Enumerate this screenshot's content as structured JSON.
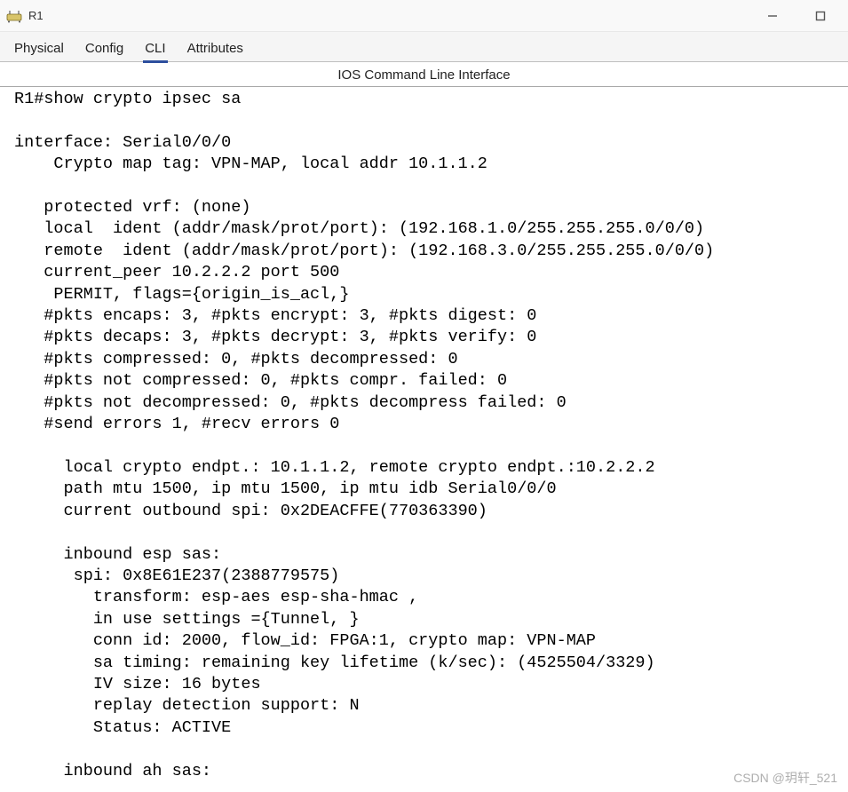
{
  "window": {
    "title": "R1",
    "icon_name": "router-icon"
  },
  "tabs": [
    {
      "label": "Physical",
      "active": false
    },
    {
      "label": "Config",
      "active": false
    },
    {
      "label": "CLI",
      "active": true
    },
    {
      "label": "Attributes",
      "active": false
    }
  ],
  "cli": {
    "subtitle": "IOS Command Line Interface",
    "prompt_line": "R1#show crypto ipsec sa",
    "interface_line": "interface: Serial0/0/0",
    "crypto_map_line": "    Crypto map tag: VPN-MAP, local addr 10.1.1.2",
    "protected_vrf": "   protected vrf: (none)",
    "local_ident": "   local  ident (addr/mask/prot/port): (192.168.1.0/255.255.255.0/0/0)",
    "remote_ident": "   remote  ident (addr/mask/prot/port): (192.168.3.0/255.255.255.0/0/0)",
    "current_peer": "   current_peer 10.2.2.2 port 500",
    "permit_line": "    PERMIT, flags={origin_is_acl,}",
    "pkts_encaps": "   #pkts encaps: 3, #pkts encrypt: 3, #pkts digest: 0",
    "pkts_decaps": "   #pkts decaps: 3, #pkts decrypt: 3, #pkts verify: 0",
    "pkts_compressed": "   #pkts compressed: 0, #pkts decompressed: 0",
    "pkts_not_comp": "   #pkts not compressed: 0, #pkts compr. failed: 0",
    "pkts_not_decomp": "   #pkts not decompressed: 0, #pkts decompress failed: 0",
    "send_errors": "   #send errors 1, #recv errors 0",
    "local_endpt": "     local crypto endpt.: 10.1.1.2, remote crypto endpt.:10.2.2.2",
    "path_mtu": "     path mtu 1500, ip mtu 1500, ip mtu idb Serial0/0/0",
    "outbound_spi": "     current outbound spi: 0x2DEACFFE(770363390)",
    "inbound_esp_hdr": "     inbound esp sas:",
    "spi_line": "      spi: 0x8E61E237(2388779575)",
    "transform": "        transform: esp-aes esp-sha-hmac ,",
    "in_use": "        in use settings ={Tunnel, }",
    "conn_id": "        conn id: 2000, flow_id: FPGA:1, crypto map: VPN-MAP",
    "sa_timing": "        sa timing: remaining key lifetime (k/sec): (4525504/3329)",
    "iv_size": "        IV size: 16 bytes",
    "replay": "        replay detection support: N",
    "status": "        Status: ACTIVE",
    "inbound_ah_hdr": "     inbound ah sas:"
  },
  "watermark": "CSDN @玥轩_521"
}
